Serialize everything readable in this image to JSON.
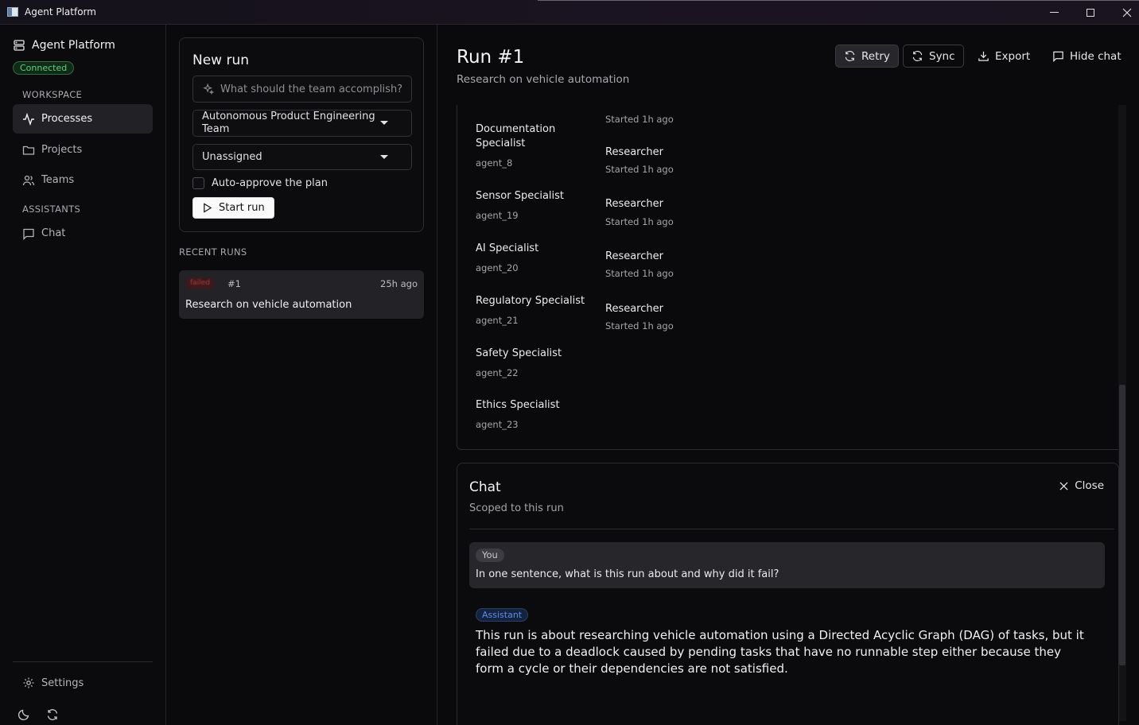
{
  "window": {
    "title": "Agent Platform"
  },
  "sidebar": {
    "brand": "Agent Platform",
    "status": "Connected",
    "workspace_label": "WORKSPACE",
    "items": [
      {
        "label": "Processes",
        "icon": "activity-icon",
        "active": true
      },
      {
        "label": "Projects",
        "icon": "folder-icon"
      },
      {
        "label": "Teams",
        "icon": "users-icon"
      }
    ],
    "assistants_label": "ASSISTANTS",
    "assistant_items": [
      {
        "label": "Chat",
        "icon": "message-icon"
      }
    ],
    "settings_label": "Settings"
  },
  "new_run": {
    "title": "New run",
    "prompt_placeholder": "What should the team accomplish?",
    "team_value": "Autonomous Product Engineering Team",
    "assignee_value": "Unassigned",
    "auto_approve_label": "Auto-approve the plan",
    "auto_approve_checked": false,
    "start_label": "Start run"
  },
  "recent_runs": {
    "label": "RECENT RUNS",
    "items": [
      {
        "status": "failed",
        "number": "#1",
        "age": "25h ago",
        "name": "Research on vehicle automation"
      }
    ]
  },
  "run": {
    "title": "Run #1",
    "subtitle": "Research on vehicle automation",
    "actions": {
      "retry": "Retry",
      "sync": "Sync",
      "export": "Export",
      "hide_chat": "Hide chat"
    },
    "agents": [
      {
        "name": "Documentation Specialist",
        "id": "agent_8"
      },
      {
        "name": "Sensor Specialist",
        "id": "agent_19"
      },
      {
        "name": "AI Specialist",
        "id": "agent_20"
      },
      {
        "name": "Regulatory Specialist",
        "id": "agent_21"
      },
      {
        "name": "Safety Specialist",
        "id": "agent_22"
      },
      {
        "name": "Ethics Specialist",
        "id": "agent_23"
      }
    ],
    "top_started": "Started 1h ago",
    "roles": [
      {
        "role": "Researcher",
        "started": "Started 1h ago"
      },
      {
        "role": "Researcher",
        "started": "Started 1h ago"
      },
      {
        "role": "Researcher",
        "started": "Started 1h ago"
      },
      {
        "role": "Researcher",
        "started": "Started 1h ago"
      }
    ]
  },
  "chat": {
    "title": "Chat",
    "subtitle": "Scoped to this run",
    "close_label": "Close",
    "user_label": "You",
    "user_message": "In one sentence, what is this run about and why did it fail?",
    "assistant_label": "Assistant",
    "assistant_message": "This run is about researching vehicle automation using a Directed Acyclic Graph (DAG) of tasks, but it failed due to a deadlock caused by pending tasks that have no runnable step either because they form a cycle or their dependencies are not satisfied."
  },
  "colors": {
    "connected": "#5fcf7a",
    "failed": "#b03a3e",
    "assistant_chip": "#5b8ee8"
  }
}
